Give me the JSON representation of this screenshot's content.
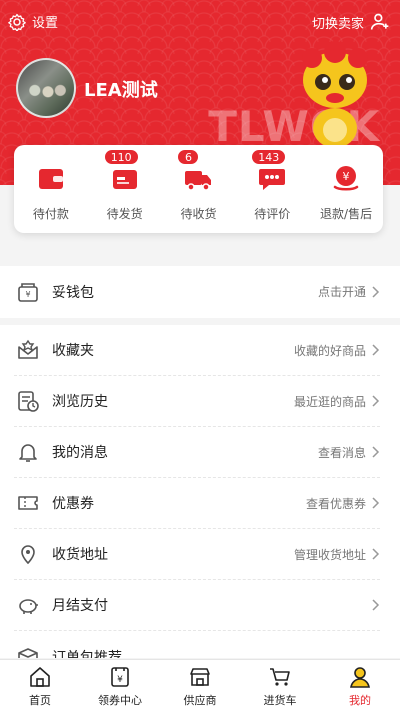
{
  "header": {
    "settings_label": "设置",
    "switch_label": "切换卖家",
    "username": "LEA测试",
    "watermark": "TLWOK"
  },
  "orders": [
    {
      "label": "待付款",
      "badge": "",
      "icon": "wallet-icon"
    },
    {
      "label": "待发货",
      "badge": "110",
      "icon": "card-icon"
    },
    {
      "label": "待收货",
      "badge": "6",
      "icon": "truck-icon"
    },
    {
      "label": "待评价",
      "badge": "143",
      "icon": "chat-icon"
    },
    {
      "label": "退款/售后",
      "badge": "",
      "icon": "refund-icon"
    }
  ],
  "menu_primary": [
    {
      "label": "妥钱包",
      "hint": "点击开通",
      "icon": "wallet-outline-icon"
    }
  ],
  "menu_secondary": [
    {
      "label": "收藏夹",
      "hint": "收藏的好商品",
      "icon": "favorites-icon"
    },
    {
      "label": "浏览历史",
      "hint": "最近逛的商品",
      "icon": "history-icon"
    },
    {
      "label": "我的消息",
      "hint": "查看消息",
      "icon": "bell-icon"
    },
    {
      "label": "优惠券",
      "hint": "查看优惠券",
      "icon": "coupon-icon"
    },
    {
      "label": "收货地址",
      "hint": "管理收货地址",
      "icon": "location-icon"
    },
    {
      "label": "月结支付",
      "hint": "",
      "icon": "piggy-bank-icon"
    },
    {
      "label": "订单包推荐",
      "hint": "",
      "icon": "package-icon"
    }
  ],
  "tabbar": [
    {
      "label": "首页",
      "icon": "home-icon",
      "active": false
    },
    {
      "label": "领券中心",
      "icon": "coupon-center-icon",
      "active": false
    },
    {
      "label": "供应商",
      "icon": "store-icon",
      "active": false
    },
    {
      "label": "进货车",
      "icon": "cart-icon",
      "active": false
    },
    {
      "label": "我的",
      "icon": "user-icon",
      "active": true
    }
  ],
  "colors": {
    "accent": "#e5282f",
    "text": "#222222",
    "hint": "#777777"
  }
}
